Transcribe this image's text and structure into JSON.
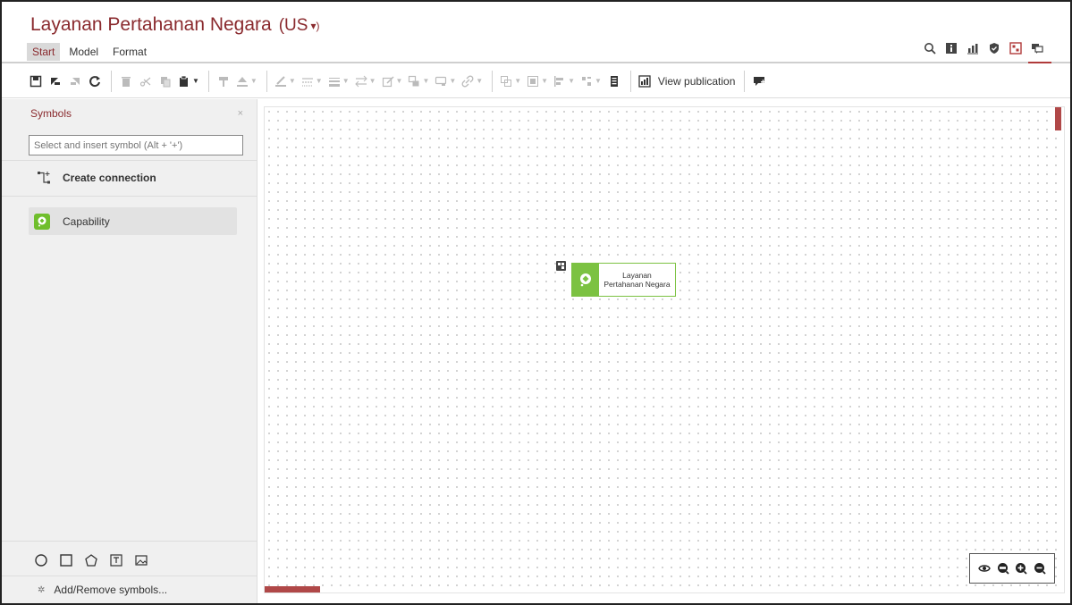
{
  "app": {
    "title": "Layanan Pertahanan Negara",
    "language": "(US",
    "language_chevron": "▾)"
  },
  "menu": {
    "tabs": [
      {
        "label": "Start",
        "active": true
      },
      {
        "label": "Model",
        "active": false
      },
      {
        "label": "Format",
        "active": false
      }
    ]
  },
  "header_icons": [
    "search-icon",
    "info-icon",
    "chart-icon",
    "shield-icon",
    "diagram-icon",
    "comments-icon"
  ],
  "toolbar": {
    "view_publication_label": "View publication"
  },
  "sidebar": {
    "title": "Symbols",
    "close_label": "×",
    "search_placeholder": "Select and insert symbol (Alt + '+')",
    "create_connection_label": "Create connection",
    "symbols": [
      {
        "label": "Capability",
        "icon": "capability-icon",
        "color": "#6fbe2c"
      }
    ],
    "shape_icons": [
      "circle-icon",
      "square-icon",
      "pentagon-icon",
      "text-box-icon",
      "image-icon"
    ],
    "add_remove_label": "Add/Remove symbols..."
  },
  "canvas": {
    "node": {
      "label_line1": "Layanan",
      "label_line2": "Pertahanan Negara",
      "icon": "capability-icon",
      "color": "#7cc242"
    },
    "zoom_controls": [
      "eye-icon",
      "zoom-100-icon",
      "zoom-in-icon",
      "zoom-out-icon"
    ]
  },
  "colors": {
    "brand": "#8a2a2e",
    "scrollbar": "#b04848",
    "capability": "#7cc242"
  }
}
